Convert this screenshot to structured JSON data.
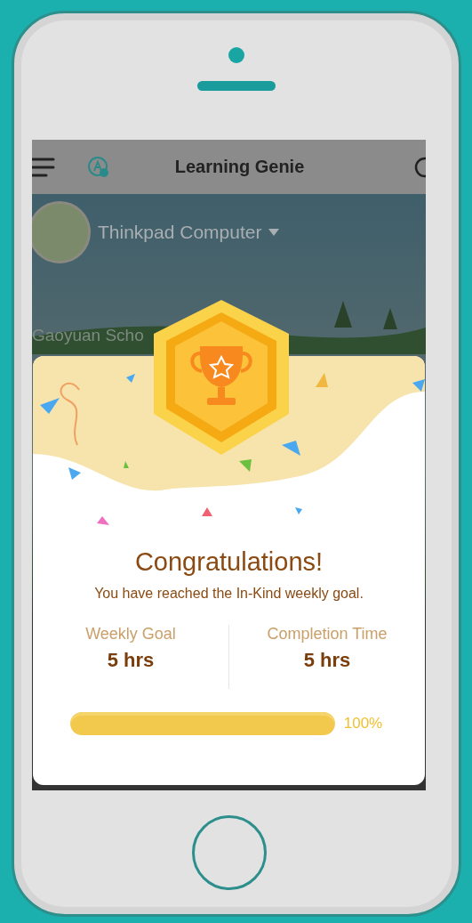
{
  "header": {
    "title": "Learning Genie"
  },
  "profile": {
    "name": "Thinkpad Computer"
  },
  "background_text": "Gaoyuan Scho",
  "dialog": {
    "title": "Congratulations!",
    "message": "You have reached the In-Kind weekly goal.",
    "stats": [
      {
        "label": "Weekly Goal",
        "value": "5 hrs"
      },
      {
        "label": "Completion Time",
        "value": "5 hrs"
      }
    ],
    "progress": {
      "level": 1,
      "reading": "100%"
    }
  }
}
